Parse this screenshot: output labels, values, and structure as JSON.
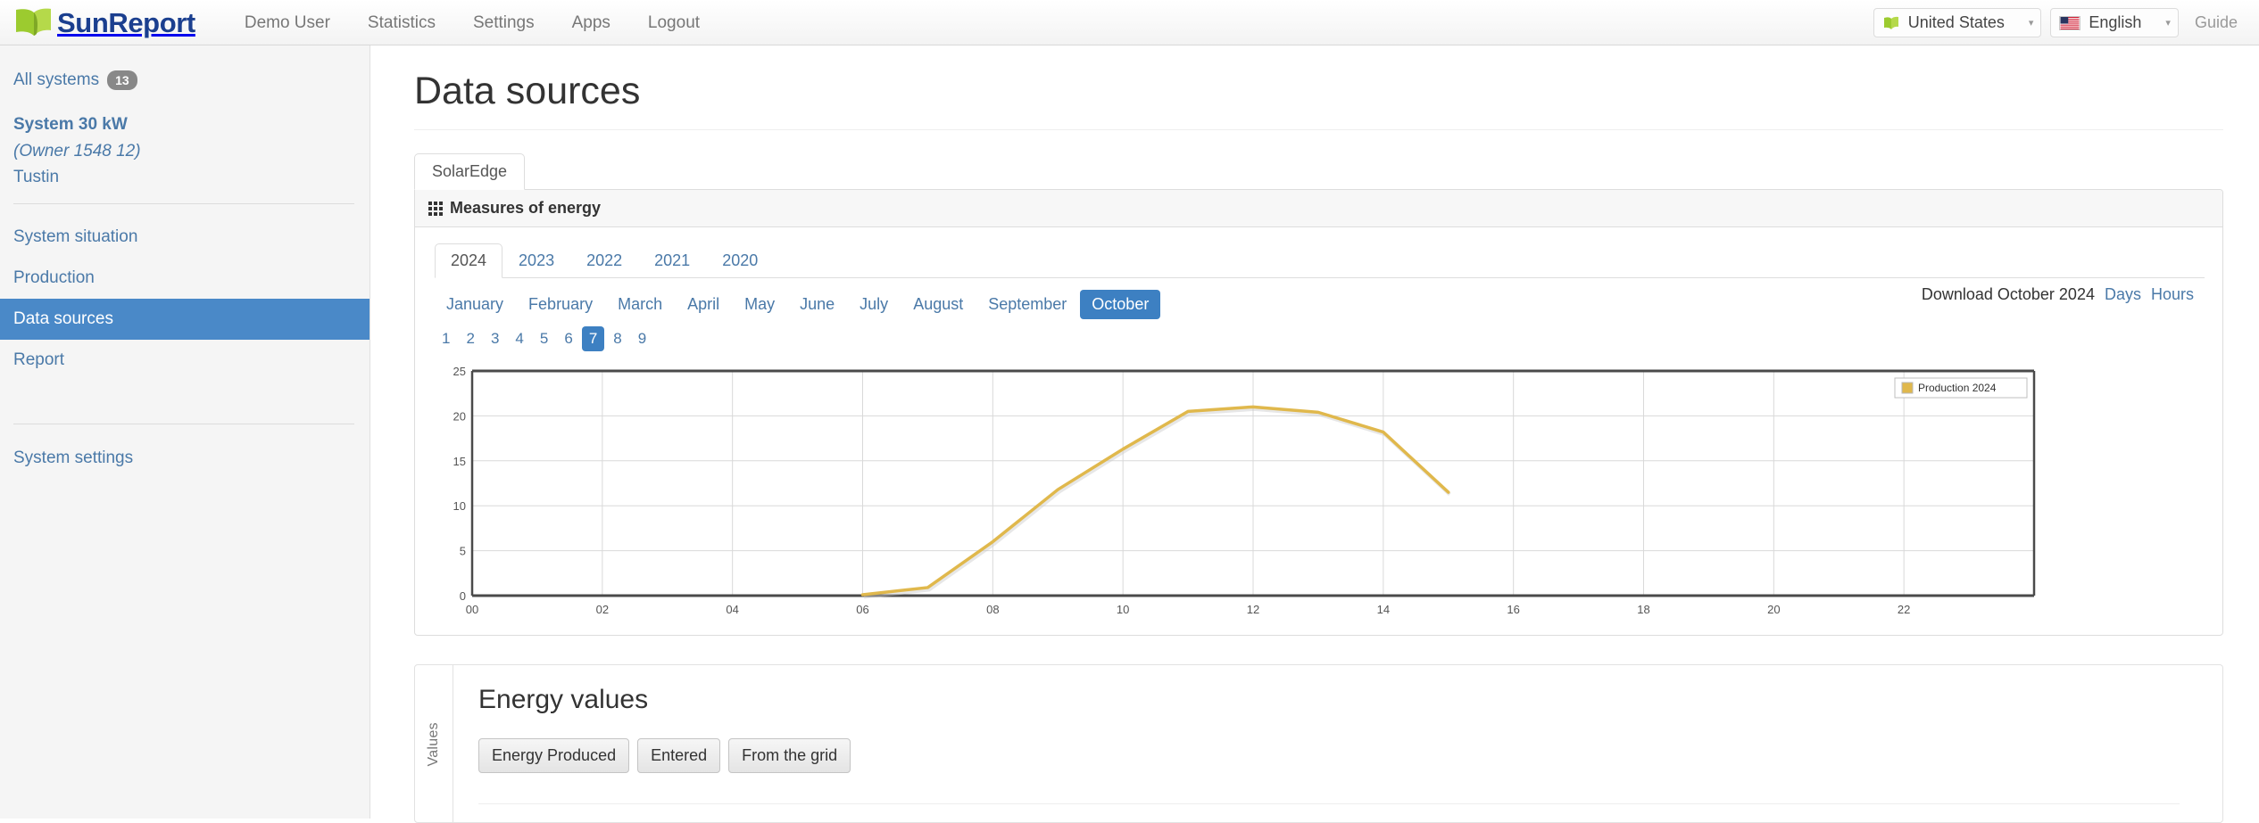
{
  "brand": {
    "name": "SunReport",
    "logo_icon": "leaf-icon"
  },
  "topnav": {
    "links": [
      "Demo User",
      "Statistics",
      "Settings",
      "Apps",
      "Logout"
    ],
    "country": {
      "label": "United States",
      "icon": "leaf-icon",
      "caret": "▾"
    },
    "language": {
      "label": "English",
      "icon": "us-flag-icon",
      "caret": "▾"
    },
    "guide": "Guide"
  },
  "sidebar": {
    "all_systems": {
      "label": "All systems",
      "count": "13"
    },
    "system": {
      "name": "System 30 kW",
      "owner": "(Owner 1548 12)",
      "city": "Tustin"
    },
    "nav": [
      {
        "label": "System situation",
        "active": false
      },
      {
        "label": "Production",
        "active": false
      },
      {
        "label": "Data sources",
        "active": true
      },
      {
        "label": "Report",
        "active": false
      }
    ],
    "settings": {
      "label": "System settings"
    }
  },
  "main": {
    "page_title": "Data sources",
    "source_tabs": [
      {
        "label": "SolarEdge",
        "active": true
      }
    ],
    "panel": {
      "header": "Measures of energy",
      "header_icon": "grid-icon",
      "years": [
        {
          "label": "2024",
          "active": true
        },
        {
          "label": "2023",
          "active": false
        },
        {
          "label": "2022",
          "active": false
        },
        {
          "label": "2021",
          "active": false
        },
        {
          "label": "2020",
          "active": false
        }
      ],
      "months": [
        {
          "label": "January",
          "active": false
        },
        {
          "label": "February",
          "active": false
        },
        {
          "label": "March",
          "active": false
        },
        {
          "label": "April",
          "active": false
        },
        {
          "label": "May",
          "active": false
        },
        {
          "label": "June",
          "active": false
        },
        {
          "label": "July",
          "active": false
        },
        {
          "label": "August",
          "active": false
        },
        {
          "label": "September",
          "active": false
        },
        {
          "label": "October",
          "active": true
        }
      ],
      "days": [
        {
          "label": "1",
          "active": false
        },
        {
          "label": "2",
          "active": false
        },
        {
          "label": "3",
          "active": false
        },
        {
          "label": "4",
          "active": false
        },
        {
          "label": "5",
          "active": false
        },
        {
          "label": "6",
          "active": false
        },
        {
          "label": "7",
          "active": true
        },
        {
          "label": "8",
          "active": false
        },
        {
          "label": "9",
          "active": false
        }
      ],
      "download": {
        "label": "Download October 2024",
        "days_link": "Days",
        "hours_link": "Hours"
      }
    },
    "values_card": {
      "side_label": "Values",
      "title": "Energy values",
      "buttons": [
        "Energy Produced",
        "Entered",
        "From the grid"
      ]
    }
  },
  "chart_data": {
    "type": "line",
    "title": "",
    "xlabel": "",
    "ylabel": "",
    "xlim": [
      0,
      24
    ],
    "ylim": [
      0,
      25
    ],
    "grid": true,
    "legend_position": "top-right",
    "line_color": "#e0b84c",
    "x_ticks": [
      "00",
      "02",
      "04",
      "06",
      "08",
      "10",
      "12",
      "14",
      "16",
      "18",
      "20",
      "22"
    ],
    "y_ticks": [
      0,
      5,
      10,
      15,
      20,
      25
    ],
    "series": [
      {
        "name": "Production 2024",
        "color": "#e0b84c",
        "x": [
          6,
          7,
          8,
          9,
          10,
          11,
          12,
          13,
          14,
          15
        ],
        "values": [
          0.1,
          0.9,
          6.0,
          11.8,
          16.3,
          20.5,
          21.0,
          20.4,
          18.2,
          11.5
        ]
      }
    ]
  }
}
